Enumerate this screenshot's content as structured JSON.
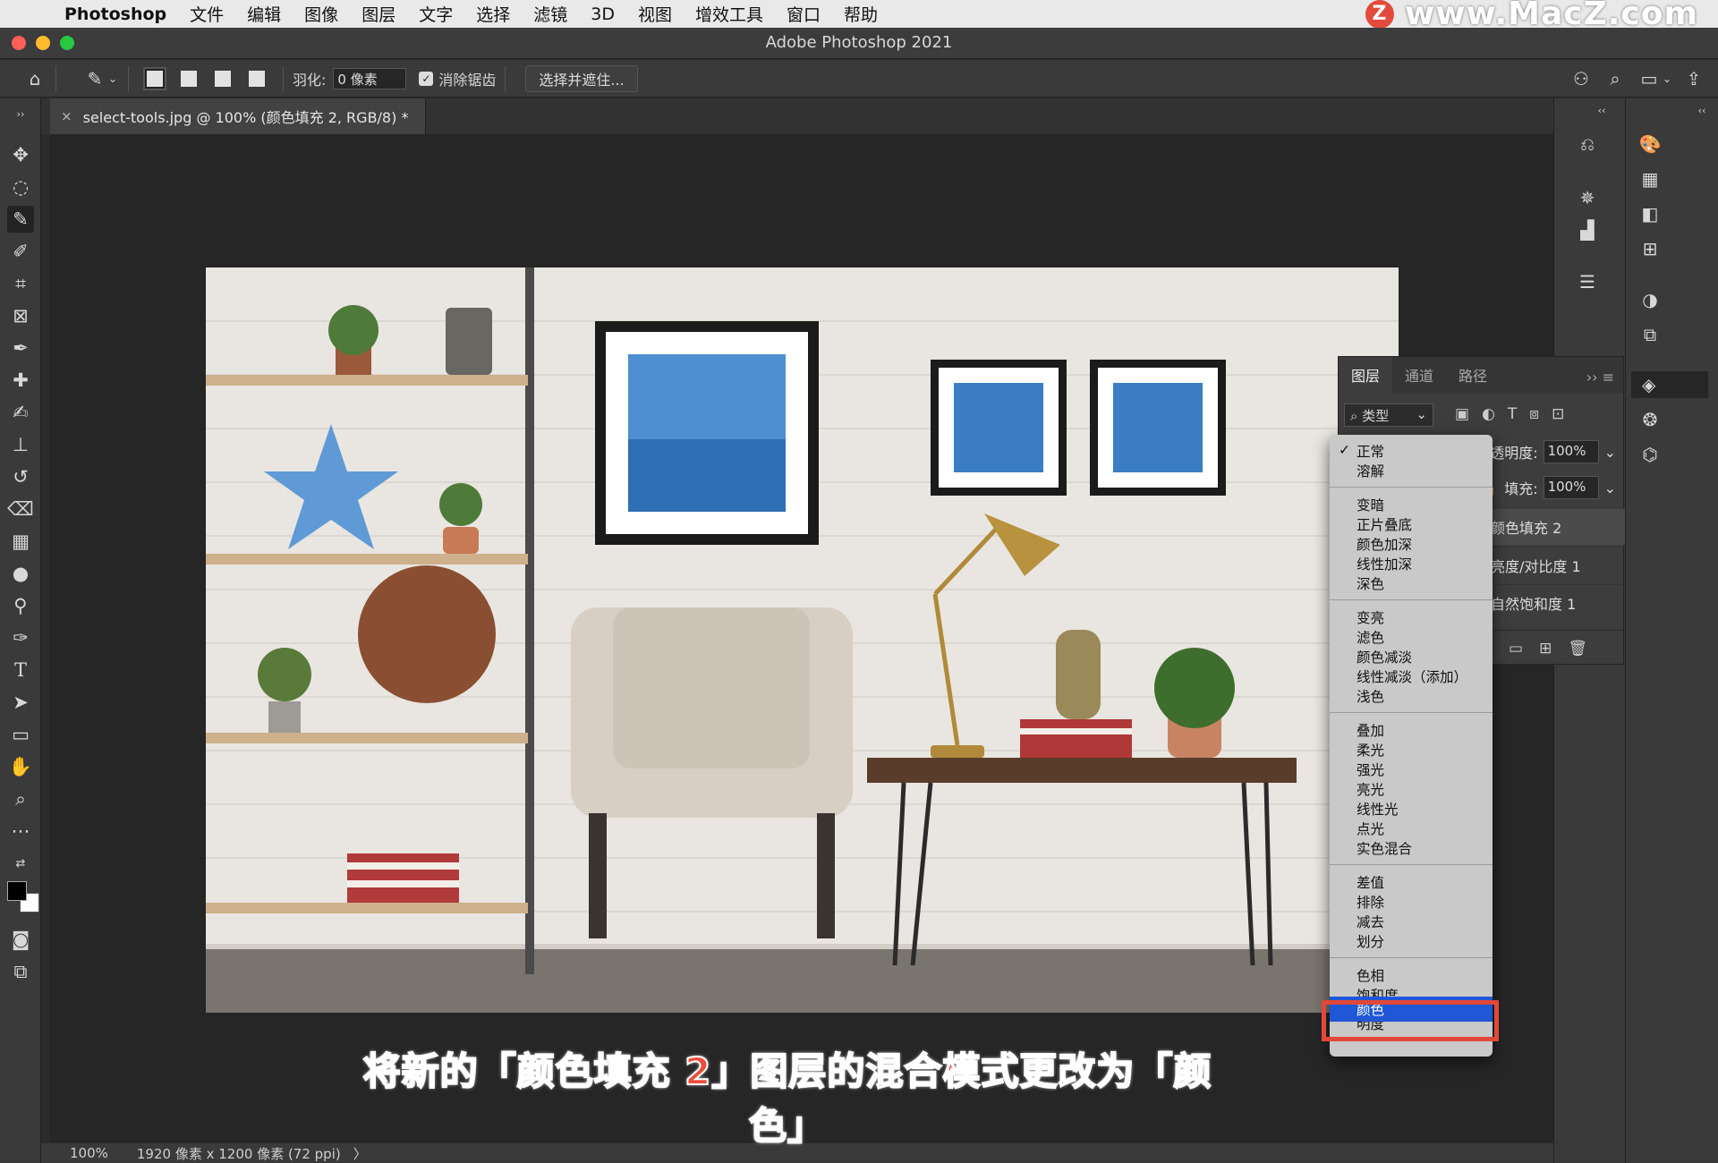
{
  "menubar": {
    "app": "Photoshop",
    "items": [
      "文件",
      "编辑",
      "图像",
      "图层",
      "文字",
      "选择",
      "滤镜",
      "3D",
      "视图",
      "增效工具",
      "窗口",
      "帮助"
    ]
  },
  "watermark": {
    "logo": "Z",
    "text": "www.MacZ.com"
  },
  "window": {
    "title": "Adobe Photoshop 2021"
  },
  "options": {
    "feather_label": "羽化:",
    "feather_value": "0 像素",
    "antialias_label": "消除锯齿",
    "antialias_checked": true,
    "select_mask_label": "选择并遮住..."
  },
  "document": {
    "tab_title": "select-tools.jpg @ 100% (颜色填充 2, RGB/8) *",
    "zoom": "100%",
    "info": "1920 像素 x 1200 像素 (72 ppi)"
  },
  "layers_panel": {
    "tabs": [
      "图层",
      "通道",
      "路径"
    ],
    "filter_label": "类型",
    "opacity_label": "不透明度:",
    "opacity_value": "100%",
    "fill_label": "填充:",
    "fill_value": "100%",
    "layers": [
      "颜色填充 2",
      "亮度/对比度 1",
      "自然饱和度 1"
    ]
  },
  "blend_menu": {
    "groups": [
      [
        "正常",
        "溶解"
      ],
      [
        "变暗",
        "正片叠底",
        "颜色加深",
        "线性加深",
        "深色"
      ],
      [
        "变亮",
        "滤色",
        "颜色减淡",
        "线性减淡（添加）",
        "浅色"
      ],
      [
        "叠加",
        "柔光",
        "强光",
        "亮光",
        "线性光",
        "点光",
        "实色混合"
      ],
      [
        "差值",
        "排除",
        "减去",
        "划分"
      ],
      [
        "色相",
        "饱和度",
        "颜色",
        "明度"
      ]
    ],
    "checked": "正常",
    "highlighted": "颜色"
  },
  "caption": "将新的「颜色填充 2」图层的混合模式更改为「颜色」",
  "colors": {
    "highlight": "#1f57d6",
    "frame": "#e2483a",
    "caption": "#ee4b3a"
  }
}
